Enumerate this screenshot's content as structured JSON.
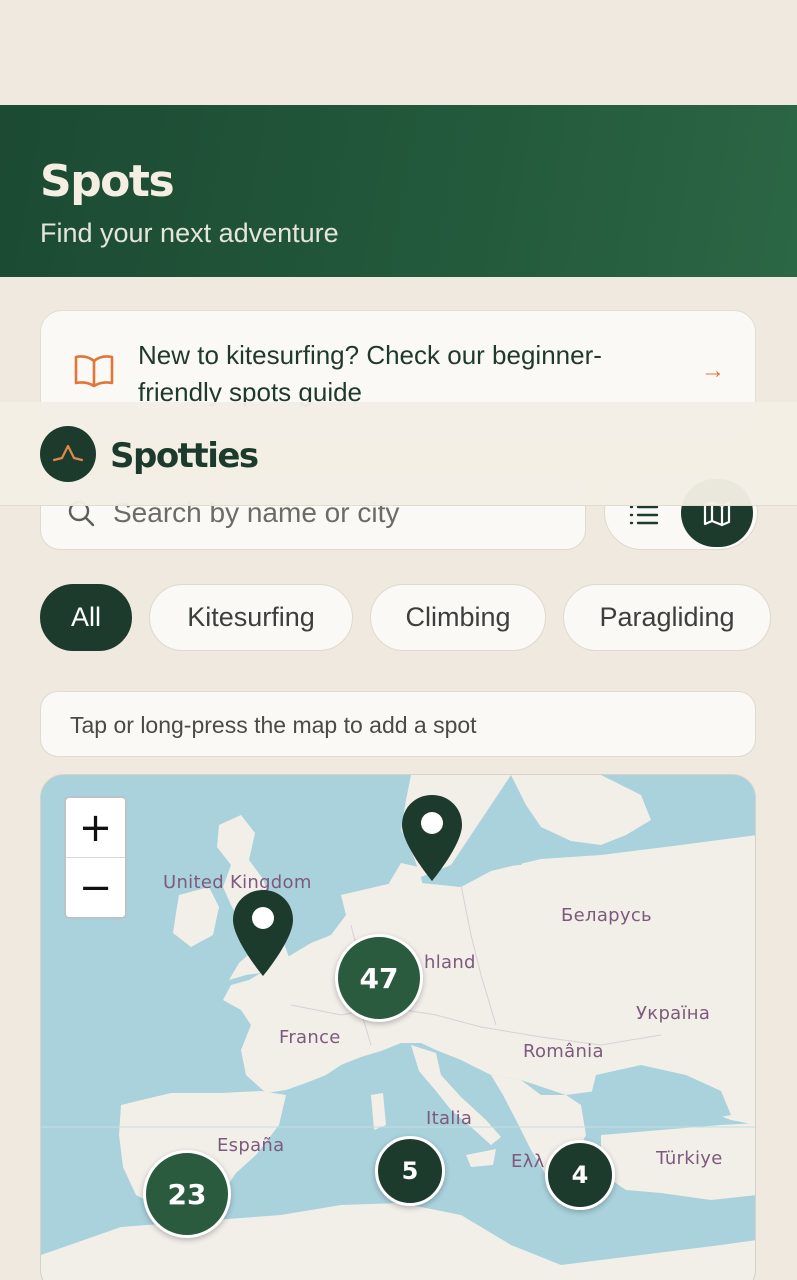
{
  "hero": {
    "title": "Spots",
    "subtitle": "Find your next adventure"
  },
  "promo": {
    "text": "New to kitesurfing? Check our beginner-friendly spots guide",
    "icon": "book-open-icon",
    "arrow": "→"
  },
  "appbar": {
    "brand": "Spotties"
  },
  "search": {
    "placeholder": "Search by name or city"
  },
  "view_toggle": {
    "options": [
      "list",
      "map"
    ],
    "selected": "map"
  },
  "filters": [
    "All",
    "Kitesurfing",
    "Climbing",
    "Paragliding"
  ],
  "selected_filter": "All",
  "hint": "Tap or long-press the map to add a spot",
  "map": {
    "zoom_in": "+",
    "zoom_out": "−",
    "labels": [
      "United Kingdom",
      "Беларусь",
      "hland",
      "Україна",
      "France",
      "România",
      "Italia",
      "España",
      "Ελλ",
      "Türkiye"
    ],
    "clusters": [
      47,
      23,
      5,
      4
    ],
    "pins": 2
  },
  "colors": {
    "primary": "#1d3b2c",
    "accent": "#e0763a",
    "background": "#efe9df",
    "water": "#a9d2dc",
    "land": "#f2efe9"
  }
}
